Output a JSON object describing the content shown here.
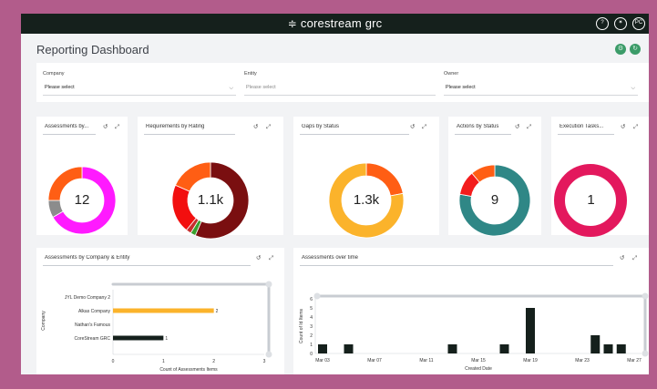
{
  "brand": {
    "name": "corestream grc",
    "glyph": "≑"
  },
  "topbar_icons": [
    {
      "name": "help-icon",
      "text": "?"
    },
    {
      "name": "accessibility-icon",
      "text": "✶"
    },
    {
      "name": "user-avatar",
      "text": "PC"
    }
  ],
  "page": {
    "title": "Reporting Dashboard"
  },
  "header_buttons": [
    "settings-icon",
    "refresh-icon"
  ],
  "filters": [
    {
      "label": "Company",
      "value": "Please select",
      "has_chevron": true,
      "muted": false
    },
    {
      "label": "Entity",
      "value": "Please select",
      "has_chevron": false,
      "muted": true
    },
    {
      "label": "Owner",
      "value": "Please select",
      "has_chevron": true,
      "muted": false
    }
  ],
  "cards": {
    "assessments_by": {
      "title": "Assessments by...",
      "center": "12"
    },
    "requirements_by_rating": {
      "title": "Requirements by Rating",
      "center": "1.1k"
    },
    "gaps_by_status": {
      "title": "Gaps by Status",
      "center": "1.3k"
    },
    "actions_by_status": {
      "title": "Actions by Status",
      "center": "9"
    },
    "execution_tasks": {
      "title": "Execution Tasks...",
      "center": "1"
    },
    "company_entity": {
      "title": "Assessments by Company & Entity"
    },
    "over_time": {
      "title": "Assessments over time"
    }
  },
  "chart_data": [
    {
      "type": "pie",
      "donut": true,
      "center_label": "12",
      "slices": [
        {
          "value": 8,
          "color": "#ff1aff"
        },
        {
          "value": 1,
          "color": "#8c8c8c"
        },
        {
          "value": 3,
          "color": "#ff5e14"
        }
      ]
    },
    {
      "type": "pie",
      "donut": true,
      "center_label": "1.1k",
      "slices": [
        {
          "value": 52,
          "color": "#7a0f10"
        },
        {
          "value": 2,
          "color": "#3aa02e"
        },
        {
          "value": 2,
          "color": "#c72e2e"
        },
        {
          "value": 19,
          "color": "#f20f0f"
        },
        {
          "value": 17,
          "color": "#ff5e14"
        }
      ]
    },
    {
      "type": "pie",
      "donut": true,
      "center_label": "1.3k",
      "slices": [
        {
          "value": 22,
          "color": "#ff5e14"
        },
        {
          "value": 78,
          "color": "#fbb32b"
        }
      ]
    },
    {
      "type": "pie",
      "donut": true,
      "center_label": "9",
      "slices": [
        {
          "value": 7,
          "color": "#2f8786"
        },
        {
          "value": 1,
          "color": "#f31c1c"
        },
        {
          "value": 1,
          "color": "#ff5e14"
        }
      ]
    },
    {
      "type": "pie",
      "donut": true,
      "center_label": "1",
      "slices": [
        {
          "value": 1,
          "color": "#e3185d"
        }
      ]
    },
    {
      "type": "bar",
      "orientation": "horizontal",
      "categories": [
        "JYL Demo Company 2",
        "Alkas Company",
        "Nathan's Famous",
        "CoreStream GRC"
      ],
      "values": [
        0,
        2,
        0,
        1
      ],
      "colors": [
        "#fbb32b",
        "#fbb32b",
        "#fbb32b",
        "#15201c"
      ],
      "data_labels": [
        "",
        "2",
        "",
        "1"
      ],
      "xlabel": "Count of Assessments Items",
      "ylabel": "Company",
      "xlim": [
        0,
        3
      ],
      "xticks": [
        "0",
        "1",
        "2",
        "3"
      ]
    },
    {
      "type": "bar",
      "orientation": "vertical",
      "x": [
        "Mar 03",
        "Mar 05",
        "Mar 13",
        "Mar 17",
        "Mar 19",
        "Mar 24",
        "Mar 25",
        "Mar 26"
      ],
      "values": [
        1,
        1,
        1,
        1,
        5,
        2,
        1,
        1
      ],
      "color": "#15201c",
      "xlabel": "Created Date",
      "ylabel": "Count of Id Items",
      "ylim": [
        0,
        6
      ],
      "yticks": [
        "0",
        "1",
        "2",
        "3",
        "4",
        "5",
        "6"
      ],
      "xticks": [
        "Mar 03",
        "Mar 07",
        "Mar 11",
        "Mar 15",
        "Mar 19",
        "Mar 23",
        "Mar 27"
      ]
    }
  ]
}
